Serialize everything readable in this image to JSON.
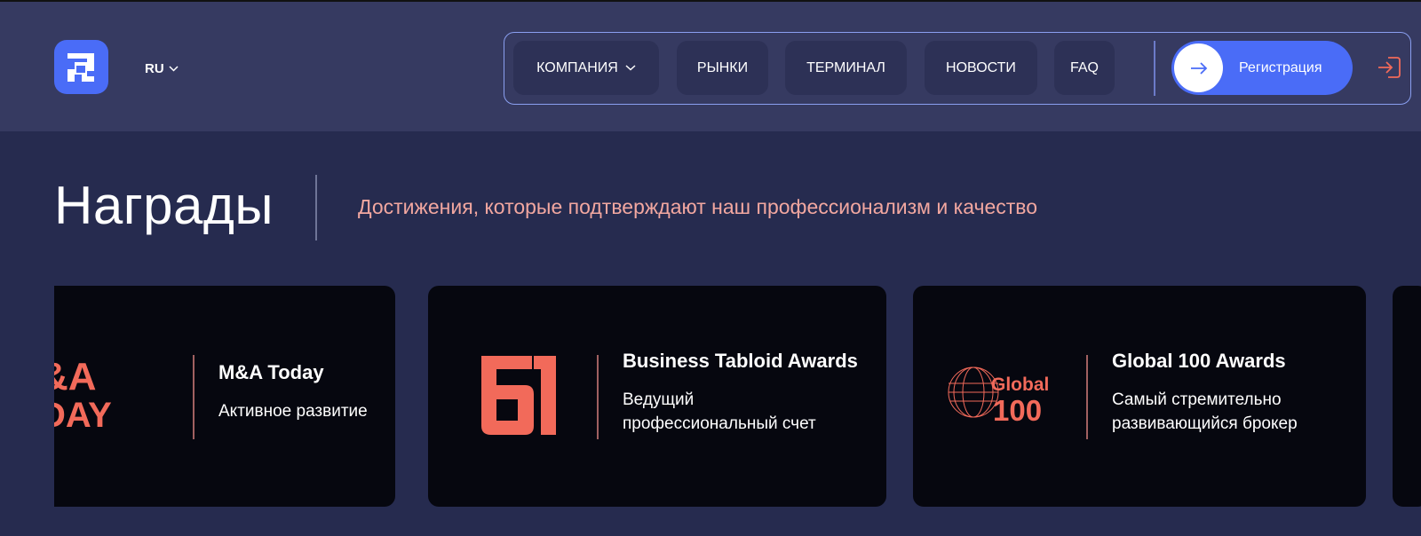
{
  "header": {
    "lang": "RU",
    "nav": [
      {
        "label": "КОМПАНИЯ",
        "has_dropdown": true
      },
      {
        "label": "РЫНКИ"
      },
      {
        "label": "ТЕРМИНАЛ"
      },
      {
        "label": "НОВОСТИ"
      },
      {
        "label": "FAQ"
      }
    ],
    "register_label": "Регистрация"
  },
  "section": {
    "title": "Награды",
    "subtitle": "Достижения, которые подтверждают наш профессионализм и качество"
  },
  "awards": [
    {
      "logo_text_1": "&A",
      "logo_text_2": "DAY",
      "title": "M&A Today",
      "desc": "Активное развитие"
    },
    {
      "title": "Business Tabloid Awards",
      "desc_line1": "Ведущий",
      "desc_line2": "профессиональный счет"
    },
    {
      "logo_text_1": "Global",
      "logo_text_2": "100",
      "title": "Global 100 Awards",
      "desc_line1": "Самый стремительно",
      "desc_line2": "развивающийся брокер"
    }
  ],
  "colors": {
    "accent": "#4a6cf7",
    "card_bg": "#06070f",
    "award_logo": "#f26a5a",
    "subtitle": "#f2a7a0"
  }
}
